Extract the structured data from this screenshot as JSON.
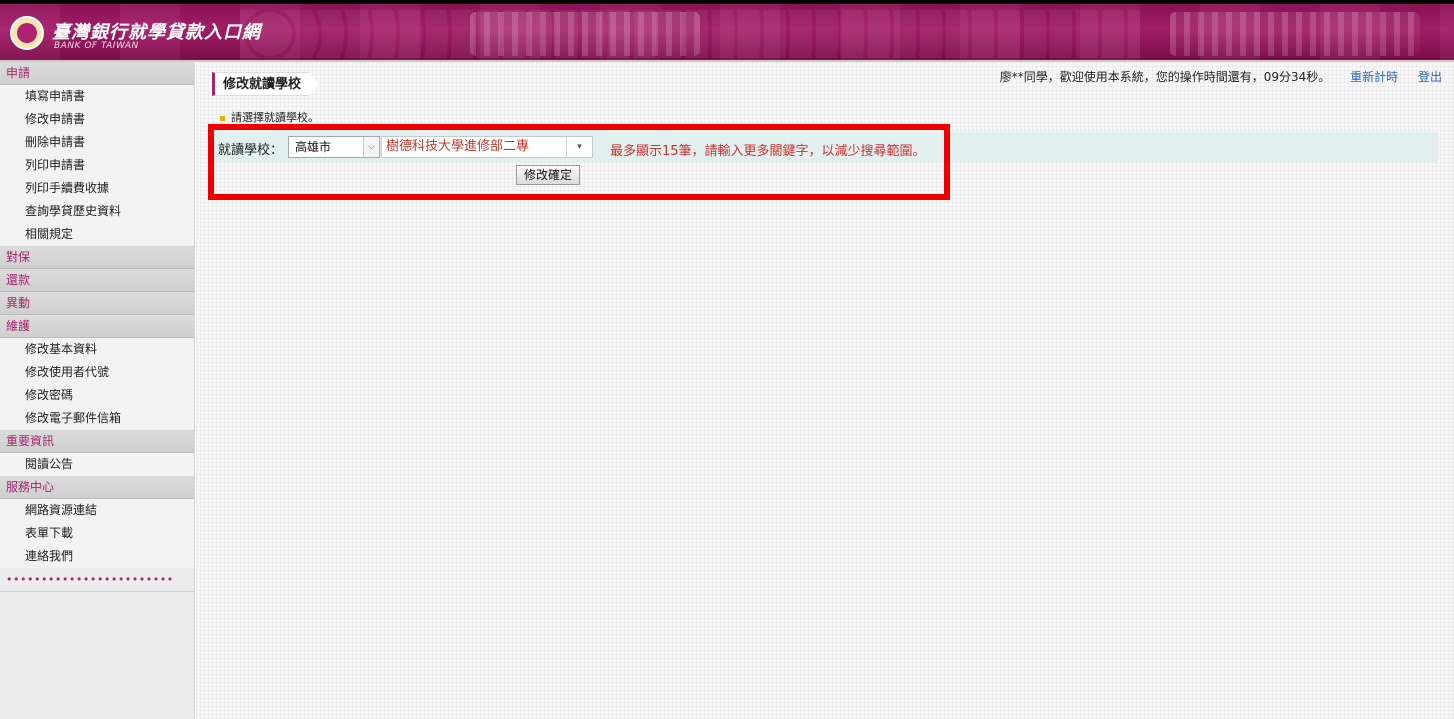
{
  "header": {
    "brand_cn": "臺灣銀行就學貸款入口網",
    "brand_en": "BANK OF TAIWAN"
  },
  "sidebar": {
    "sections": [
      {
        "title": "申請",
        "items": [
          "填寫申請書",
          "修改申請書",
          "刪除申請書",
          "列印申請書",
          "列印手續費收據",
          "查詢學貸歷史資料",
          "相關規定"
        ]
      },
      {
        "title": "對保",
        "items": []
      },
      {
        "title": "還款",
        "items": []
      },
      {
        "title": "異動",
        "items": []
      },
      {
        "title": "維護",
        "items": [
          "修改基本資料",
          "修改使用者代號",
          "修改密碼",
          "修改電子郵件信箱"
        ]
      },
      {
        "title": "重要資訊",
        "items": [
          "閱讀公告"
        ]
      },
      {
        "title": "服務中心",
        "items": [
          "網路資源連結",
          "表單下載",
          "連絡我們"
        ]
      }
    ],
    "dots": "••••••••••••••••••••••••"
  },
  "main": {
    "page_title": "修改就讀學校",
    "welcome_text": "廖**同學，歡迎使用本系統，您的操作時間還有，09分34秒。",
    "reset_timer": "重新計時",
    "logout": "登出",
    "hint": "請選擇就讀學校。",
    "school_label": "就讀學校：",
    "city_value": "高雄市",
    "school_value": "樹德科技大學進修部二專",
    "warning": "最多顯示15筆，請輸入更多關鍵字，以減少搜尋範圍。",
    "submit_label": "修改確定"
  },
  "colors": {
    "header": "#8e1358",
    "accent": "#a3266d",
    "warning": "#d0312d",
    "highlight": "#ee0000",
    "link": "#2a66c5"
  }
}
